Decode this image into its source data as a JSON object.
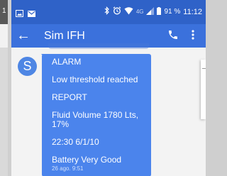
{
  "left_strip": {
    "clock_fragment": "1"
  },
  "status_bar": {
    "network": "4G",
    "battery_percent": "91 %",
    "time": "11:12",
    "icons": [
      "gallery-icon",
      "email-icon",
      "bluetooth-icon",
      "alarm-icon",
      "wifi-icon",
      "signal-icon",
      "battery-icon"
    ]
  },
  "toolbar": {
    "title": "Sim IFH",
    "back_icon": "arrow-back-icon",
    "call_icon": "phone-icon",
    "menu_icon": "overflow-menu-icon"
  },
  "conversation": {
    "avatar_letter": "S",
    "message": {
      "lines": [
        "ALARM",
        "Low threshold reached",
        "REPORT",
        "Fluid Volume 1780 Lts, 17%",
        "22:30 6/1/10",
        "Battery  Very Good"
      ],
      "timestamp": "26 ago. 9:51"
    }
  },
  "colors": {
    "status_bar": "#2f62c8",
    "toolbar": "#3b71dc",
    "bubble": "#4b84ec",
    "avatar": "#4e86e4",
    "background": "#f3f3f3"
  }
}
